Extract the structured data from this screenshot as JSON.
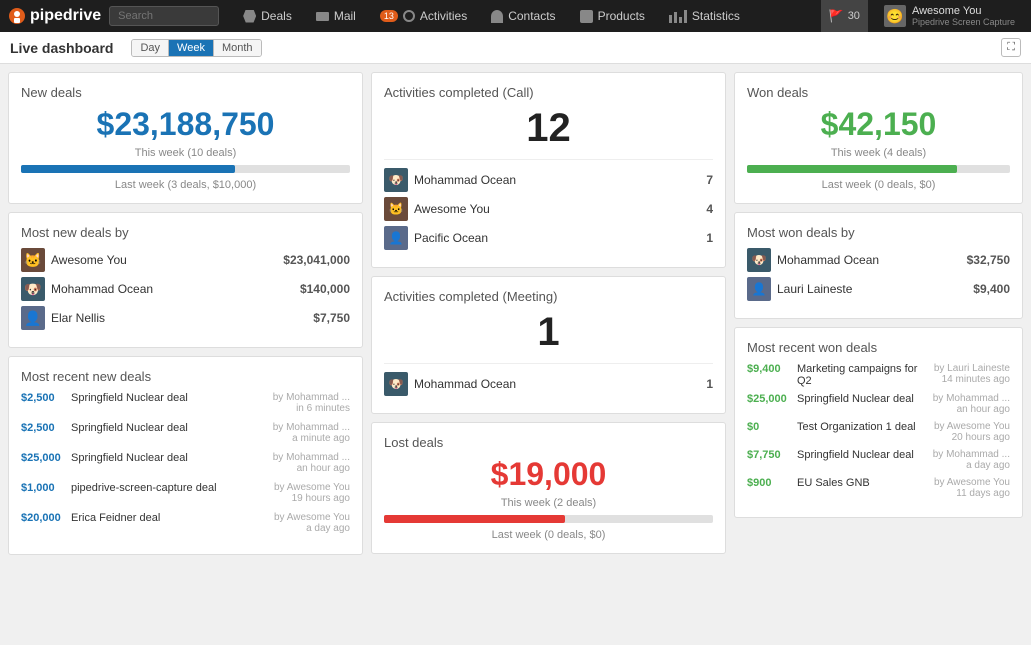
{
  "nav": {
    "logo": "pipedrive",
    "search_placeholder": "Search",
    "items": [
      {
        "label": "Deals",
        "badge": null
      },
      {
        "label": "Mail",
        "badge": null
      },
      {
        "label": "Activities",
        "badge": "13"
      },
      {
        "label": "Contacts",
        "badge": null
      },
      {
        "label": "Products",
        "badge": null
      },
      {
        "label": "Statistics",
        "badge": null
      }
    ],
    "flag_badge": "30",
    "user_name": "Awesome You",
    "user_sub": "Pipedrive Screen Capture"
  },
  "toolbar": {
    "title": "Live dashboard",
    "btn_day": "Day",
    "btn_week": "Week",
    "btn_month": "Month",
    "active": "Week"
  },
  "new_deals": {
    "title": "New deals",
    "value": "$23,188,750",
    "week_label": "This week (10 deals)",
    "last_week_label": "Last week (3 deals, $10,000)",
    "progress_pct": 65
  },
  "most_new_deals": {
    "title": "Most new deals by",
    "people": [
      {
        "name": "Awesome You",
        "value": "$23,041,000",
        "avatar": "🐱"
      },
      {
        "name": "Mohammad Ocean",
        "value": "$140,000",
        "avatar": "🐶"
      },
      {
        "name": "Elar Nellis",
        "value": "$7,750",
        "avatar": "👤"
      }
    ]
  },
  "most_recent_new_deals": {
    "title": "Most recent new deals",
    "deals": [
      {
        "amount": "$2,500",
        "name": "Springfield Nuclear deal",
        "by": "by Mohammad ...",
        "time": "in 6 minutes"
      },
      {
        "amount": "$2,500",
        "name": "Springfield Nuclear deal",
        "by": "by Mohammad ...",
        "time": "a minute ago"
      },
      {
        "amount": "$25,000",
        "name": "Springfield Nuclear deal",
        "by": "by Mohammad ...",
        "time": "an hour ago"
      },
      {
        "amount": "$1,000",
        "name": "pipedrive-screen-capture deal",
        "by": "by Awesome You",
        "time": "19 hours ago"
      },
      {
        "amount": "$20,000",
        "name": "Erica Feidner deal",
        "by": "by Awesome You",
        "time": "a day ago"
      }
    ]
  },
  "activities_call": {
    "title": "Activities completed (Call)",
    "value": "12",
    "people": [
      {
        "name": "Mohammad Ocean",
        "value": "7",
        "avatar": "🐶"
      },
      {
        "name": "Awesome You",
        "value": "4",
        "avatar": "🐱"
      },
      {
        "name": "Pacific Ocean",
        "value": "1",
        "avatar": "👤"
      }
    ]
  },
  "activities_meeting": {
    "title": "Activities completed (Meeting)",
    "value": "1",
    "people": [
      {
        "name": "Mohammad Ocean",
        "value": "1",
        "avatar": "🐶"
      }
    ]
  },
  "lost_deals": {
    "title": "Lost deals",
    "value": "$19,000",
    "week_label": "This week (2 deals)",
    "last_week_label": "Last week (0 deals, $0)",
    "progress_pct": 55
  },
  "won_deals": {
    "title": "Won deals",
    "value": "$42,150",
    "week_label": "This week (4 deals)",
    "last_week_label": "Last week (0 deals, $0)",
    "progress_pct": 80
  },
  "most_won_deals": {
    "title": "Most won deals by",
    "people": [
      {
        "name": "Mohammad Ocean",
        "value": "$32,750",
        "avatar": "🐶"
      },
      {
        "name": "Lauri Laineste",
        "value": "$9,400",
        "avatar": "👤"
      }
    ]
  },
  "most_recent_won": {
    "title": "Most recent won deals",
    "deals": [
      {
        "amount": "$9,400",
        "name": "Marketing campaigns for Q2",
        "by": "by Lauri Laineste",
        "time": "14 minutes ago"
      },
      {
        "amount": "$25,000",
        "name": "Springfield Nuclear deal",
        "by": "by Mohammad ...",
        "time": "an hour ago"
      },
      {
        "amount": "$0",
        "name": "Test Organization 1 deal",
        "by": "by Awesome You",
        "time": "20 hours ago"
      },
      {
        "amount": "$7,750",
        "name": "Springfield Nuclear deal",
        "by": "by Mohammad ...",
        "time": "a day ago"
      },
      {
        "amount": "$900",
        "name": "EU Sales GNB",
        "by": "by Awesome You",
        "time": "11 days ago"
      }
    ]
  }
}
